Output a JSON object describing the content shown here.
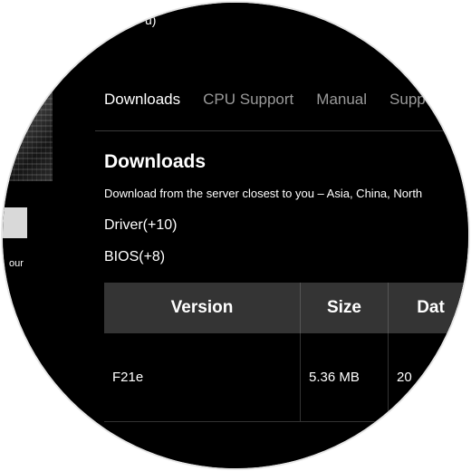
{
  "header": {
    "partial_text": "u)"
  },
  "left": {
    "partial_text": "our"
  },
  "tabs": [
    {
      "label": "Downloads",
      "active": true
    },
    {
      "label": "CPU Support",
      "active": false
    },
    {
      "label": "Manual",
      "active": false
    },
    {
      "label": "Supp",
      "active": false
    }
  ],
  "downloads": {
    "title": "Downloads",
    "description": "Download from the server closest to you – Asia, China, North",
    "categories": [
      {
        "label": "Driver(+10)"
      },
      {
        "label": "BIOS(+8)"
      }
    ],
    "table": {
      "headers": [
        "Version",
        "Size",
        "Dat"
      ],
      "rows": [
        {
          "version": "F21e",
          "size": "5.36 MB",
          "date": "20"
        }
      ]
    }
  },
  "colors": {
    "background": "#000000",
    "header_bg": "#343434",
    "tab_active": "#ffffff",
    "tab_inactive": "#9a9a9a"
  }
}
